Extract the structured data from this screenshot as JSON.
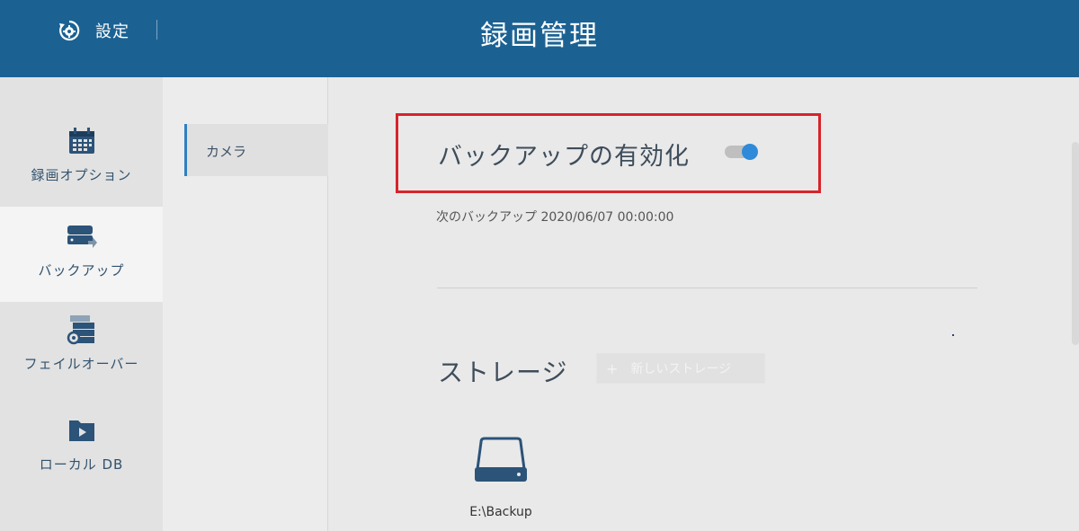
{
  "header": {
    "settings_label": "設定",
    "title": "録画管理",
    "settings_icon": "gear-refresh-icon"
  },
  "nav": {
    "items": [
      {
        "label": "録画オプション",
        "icon": "calendar-icon",
        "active": false
      },
      {
        "label": "バックアップ",
        "icon": "drive-transfer-icon",
        "active": true
      },
      {
        "label": "フェイルオーバー",
        "icon": "server-failover-icon",
        "active": false
      },
      {
        "label": "ローカル DB",
        "icon": "folder-play-icon",
        "active": false
      }
    ]
  },
  "subnav": {
    "items": [
      {
        "label": "カメラ",
        "active": true
      }
    ]
  },
  "main": {
    "backup_enable_label": "バックアップの有効化",
    "backup_enabled": true,
    "next_backup": "次のバックアップ 2020/06/07 00:00:00",
    "storage_title": "ストレージ",
    "new_storage_label": "新しいストレージ",
    "storages": [
      {
        "label": "E:\\Backup",
        "icon": "hard-drive-icon"
      }
    ]
  },
  "colors": {
    "header_bg": "#1b6293",
    "accent": "#2f8ad9",
    "highlight": "#d7232c"
  }
}
